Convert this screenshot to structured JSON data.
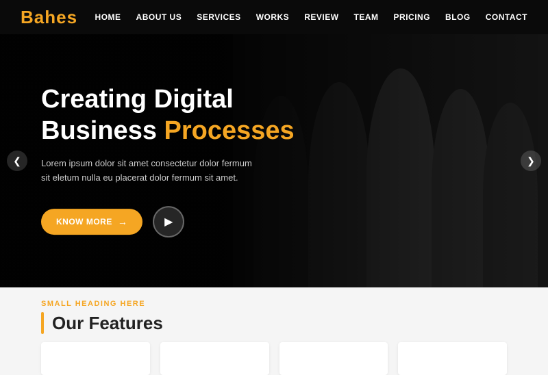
{
  "navbar": {
    "logo": "Bahes",
    "links": [
      {
        "label": "HOME",
        "id": "home"
      },
      {
        "label": "ABOUT US",
        "id": "about"
      },
      {
        "label": "SERVICES",
        "id": "services"
      },
      {
        "label": "WORKS",
        "id": "works"
      },
      {
        "label": "REVIEW",
        "id": "review"
      },
      {
        "label": "TEAM",
        "id": "team"
      },
      {
        "label": "PRICING",
        "id": "pricing"
      },
      {
        "label": "BLOG",
        "id": "blog"
      },
      {
        "label": "CONTACT",
        "id": "contact"
      }
    ]
  },
  "hero": {
    "title_line1": "Creating Digital",
    "title_line2": "Business ",
    "title_highlight": "Processes",
    "subtitle": "Lorem ipsum dolor sit amet consectetur dolor fermum sit eletum nulla eu placerat dolor fermum sit amet.",
    "cta_label": "KNOW MORE",
    "play_icon": "▶"
  },
  "features": {
    "small_heading": "SMALL HEADING HERE",
    "heading": "Our Features"
  },
  "arrows": {
    "left": "❮",
    "right": "❯"
  }
}
